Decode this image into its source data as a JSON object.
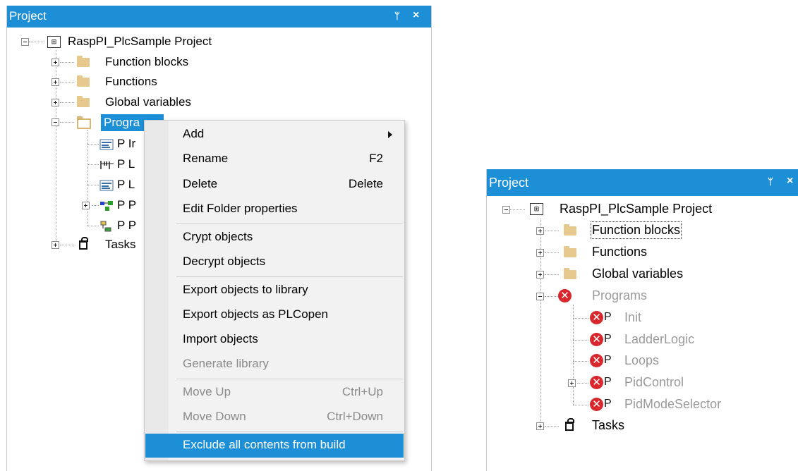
{
  "left_panel": {
    "title": "Project",
    "pin_glyph": "ᛘ",
    "close_glyph": "×",
    "tree": {
      "root": "RaspPI_PlcSample Project",
      "function_blocks": "Function blocks",
      "functions": "Functions",
      "global_variables": "Global variables",
      "programs": "Progra",
      "program_items": [
        {
          "label": "P Ir",
          "icon": "structured-text-icon"
        },
        {
          "label": "P L",
          "icon": "ladder-icon"
        },
        {
          "label": "P L",
          "icon": "structured-text-icon"
        },
        {
          "label": "P P",
          "icon": "fbd-icon"
        },
        {
          "label": "P P",
          "icon": "sfc-icon"
        }
      ],
      "tasks": "Tasks"
    }
  },
  "context_menu": {
    "items": [
      {
        "label": "Add",
        "shortcut": "",
        "submenu": true,
        "enabled": true
      },
      {
        "label": "Rename",
        "shortcut": "F2",
        "enabled": true
      },
      {
        "label": "Delete",
        "shortcut": "Delete",
        "enabled": true
      },
      {
        "label": "Edit Folder properties",
        "shortcut": "",
        "enabled": true
      },
      {
        "label": "Crypt objects",
        "shortcut": "",
        "enabled": true
      },
      {
        "label": "Decrypt objects",
        "shortcut": "",
        "enabled": true
      },
      {
        "label": "Export objects to library",
        "shortcut": "",
        "enabled": true
      },
      {
        "label": "Export objects as PLCopen",
        "shortcut": "",
        "enabled": true
      },
      {
        "label": "Import objects",
        "shortcut": "",
        "enabled": true
      },
      {
        "label": "Generate library",
        "shortcut": "",
        "enabled": false
      },
      {
        "label": "Move Up",
        "shortcut": "Ctrl+Up",
        "enabled": false
      },
      {
        "label": "Move Down",
        "shortcut": "Ctrl+Down",
        "enabled": false
      },
      {
        "label": "Exclude all contents from build",
        "shortcut": "",
        "enabled": true,
        "highlighted": true
      }
    ]
  },
  "right_panel": {
    "title": "Project",
    "pin_glyph": "ᛘ",
    "close_glyph": "×",
    "tree": {
      "root": "RaspPI_PlcSample Project",
      "function_blocks": "Function blocks",
      "functions": "Functions",
      "global_variables": "Global variables",
      "programs": "Programs",
      "program_items": [
        {
          "label": "Init",
          "excluded": true
        },
        {
          "label": "LadderLogic",
          "excluded": true
        },
        {
          "label": "Loops",
          "excluded": true
        },
        {
          "label": "PidControl",
          "excluded": true
        },
        {
          "label": "PidModeSelector",
          "excluded": true
        }
      ],
      "tasks": "Tasks",
      "error_glyph": "✕",
      "program_prefix": "P"
    }
  },
  "colors": {
    "accent": "#1c8fd6",
    "folder": "#e7c88d",
    "error": "#d8282e",
    "disabled_text": "#9a9a9a"
  }
}
